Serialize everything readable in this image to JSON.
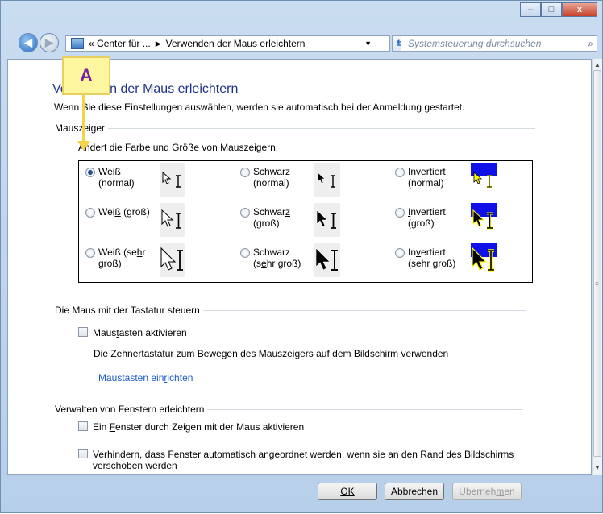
{
  "window": {
    "caption_buttons": {
      "minimize": "–",
      "maximize": "□",
      "close": "x"
    }
  },
  "nav": {
    "back_glyph": "◀",
    "forward_glyph": "▶",
    "breadcrumb": [
      "«",
      "Center für ...",
      "Verwenden der Maus erleichtern"
    ],
    "breadcrumb_sep": "▶",
    "dropdown_glyph": "▼",
    "refresh_glyph": "⇆",
    "search_placeholder": "Systemsteuerung durchsuchen",
    "search_icon": "⌕"
  },
  "page": {
    "title": "Verwenden der Maus erleichtern",
    "subtitle": "Wenn Sie diese Einstellungen auswählen, werden sie automatisch bei der Anmeldung gestartet."
  },
  "mouse_pointers": {
    "section_label": "Mauszeiger",
    "description": "Ändert die Farbe und Größe von Mauszeigern.",
    "options": [
      {
        "label": "Weiß (normal)",
        "checked": true,
        "style": "white",
        "size": "normal"
      },
      {
        "label": "Schwarz (normal)",
        "checked": false,
        "style": "black",
        "size": "normal"
      },
      {
        "label": "Invertiert (normal)",
        "checked": false,
        "style": "inverted",
        "size": "normal"
      },
      {
        "label": "Weiß (groß)",
        "checked": false,
        "style": "white",
        "size": "large"
      },
      {
        "label": "Schwarz (groß)",
        "checked": false,
        "style": "black",
        "size": "large"
      },
      {
        "label": "Invertiert (groß)",
        "checked": false,
        "style": "inverted",
        "size": "large"
      },
      {
        "label": "Weiß (sehr groß)",
        "checked": false,
        "style": "white",
        "size": "extra-large"
      },
      {
        "label": "Schwarz (sehr groß)",
        "checked": false,
        "style": "black",
        "size": "extra-large"
      },
      {
        "label": "Invertiert (sehr groß)",
        "checked": false,
        "style": "inverted",
        "size": "extra-large"
      }
    ]
  },
  "keyboard": {
    "section_label": "Die Maus mit der Tastatur steuern",
    "mousekeys_label": "Maustasten aktivieren",
    "mousekeys_checked": false,
    "mousekeys_description": "Die Zehnertastatur zum Bewegen des Mauszeigers auf dem Bildschirm verwenden",
    "setup_link": "Maustasten einrichten"
  },
  "windows": {
    "section_label": "Verwalten von Fenstern erleichtern",
    "hover_activate_label": "Ein Fenster durch Zeigen mit der Maus aktivieren",
    "hover_activate_checked": false,
    "prevent_arrange_label": "Verhindern, dass Fenster automatisch angeordnet werden, wenn sie an den Rand des Bildschirms verschoben werden",
    "prevent_arrange_checked": false
  },
  "buttons": {
    "ok": "OK",
    "cancel": "Abbrechen",
    "apply": "Übernehmen"
  },
  "annotation": {
    "callout_letter": "A"
  },
  "colors": {
    "heading": "#1e3287",
    "link": "#1d5cc6",
    "callout_bg": "#fff7a0",
    "callout_text": "#7a1f9a",
    "callout_arrow": "#f2d34a"
  }
}
